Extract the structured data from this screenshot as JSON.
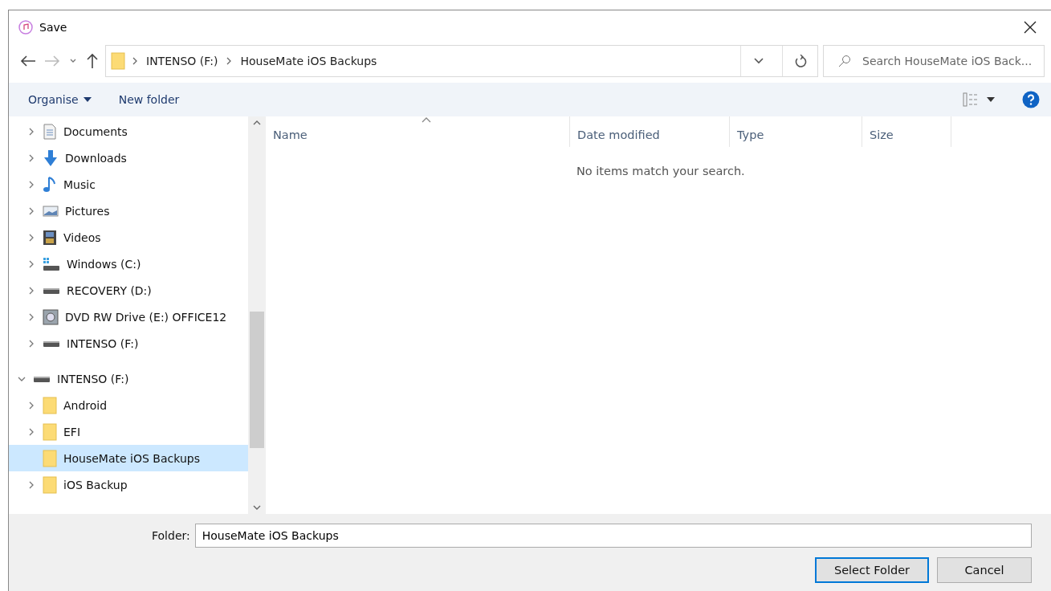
{
  "window": {
    "title": "Save"
  },
  "address_bar": {
    "path": [
      "INTENSO (F:)",
      "HouseMate iOS Backups"
    ]
  },
  "search": {
    "placeholder": "Search HouseMate iOS Back..."
  },
  "toolbar": {
    "organise": "Organise",
    "new_folder": "New folder"
  },
  "tree": [
    {
      "children": [
        {
          "label": "Documents",
          "kind": "document",
          "expanded": false,
          "selected": false
        },
        {
          "label": "Downloads",
          "kind": "download",
          "expanded": false,
          "selected": false
        },
        {
          "label": "Music",
          "kind": "music",
          "expanded": false,
          "selected": false
        },
        {
          "label": "Pictures",
          "kind": "pictures",
          "expanded": false,
          "selected": false
        },
        {
          "label": "Videos",
          "kind": "videos",
          "expanded": false,
          "selected": false
        },
        {
          "label": "Windows (C:)",
          "kind": "system-drive",
          "expanded": false,
          "selected": false
        },
        {
          "label": "RECOVERY (D:)",
          "kind": "drive",
          "expanded": false,
          "selected": false
        },
        {
          "label": "DVD RW Drive (E:) OFFICE12",
          "kind": "dvd",
          "expanded": false,
          "selected": false
        },
        {
          "label": "INTENSO (F:)",
          "kind": "drive",
          "expanded": false,
          "selected": false
        }
      ]
    },
    {
      "label": "INTENSO (F:)",
      "kind": "drive",
      "expanded": true,
      "selected": false,
      "children": [
        {
          "label": "Android",
          "kind": "folder",
          "expanded": false,
          "selected": false
        },
        {
          "label": "EFI",
          "kind": "folder",
          "expanded": false,
          "selected": false
        },
        {
          "label": "HouseMate iOS Backups",
          "kind": "folder",
          "expanded": false,
          "selected": true,
          "leaf": true
        },
        {
          "label": "iOS Backup",
          "kind": "folder",
          "expanded": false,
          "selected": false
        }
      ]
    }
  ],
  "columns": [
    "Name",
    "Date modified",
    "Type",
    "Size"
  ],
  "empty_message": "No items match your search.",
  "folder_field": {
    "label": "Folder:",
    "value": "HouseMate iOS Backups"
  },
  "buttons": [
    {
      "label": "Select Folder",
      "kind": "primary"
    },
    {
      "label": "Cancel",
      "kind": "secondary"
    }
  ]
}
